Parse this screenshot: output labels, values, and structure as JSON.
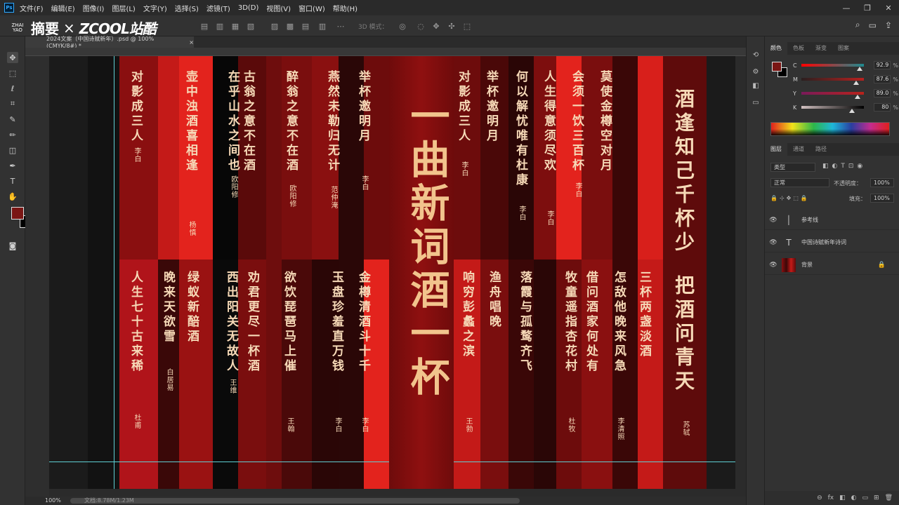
{
  "app": {
    "logo": "Ps",
    "menu": [
      "文件(F)",
      "编辑(E)",
      "图像(I)",
      "图层(L)",
      "文字(Y)",
      "选择(S)",
      "滤镜(T)",
      "3D(D)",
      "视图(V)",
      "窗口(W)",
      "帮助(H)"
    ],
    "window_controls": [
      "—",
      "❐",
      "✕"
    ]
  },
  "banner": {
    "mark_lines": [
      "ZHAI",
      "YAO"
    ],
    "zhaiyao": "摘要",
    "x": "×",
    "zcool": "ZCOOL站酷"
  },
  "options": {
    "mode_3d": "3D 模式："
  },
  "document": {
    "tab_title": "2024文案（中国诗赋新年）.psd @ 100% (CMYK/8#) *",
    "tab_close": "×",
    "zoom": "100%",
    "status": "文档:8.78M/1.23M"
  },
  "poster": {
    "title": "一曲新词酒一杯",
    "top_poems": [
      {
        "text": "对影成三人",
        "author": "李白"
      },
      {
        "text": "壶中浊酒喜相逢",
        "author": "杨慎"
      },
      {
        "text": "古翁之意不在酒",
        "author": ""
      },
      {
        "text": "在乎山水之间也",
        "author": "欧阳修"
      },
      {
        "text": "醉翁之意不在酒",
        "author": "欧阳修"
      },
      {
        "text": "燕然未勒归无计",
        "author": "范仲淹"
      },
      {
        "text": "举杯邀明月",
        "author": "李白"
      },
      {
        "text": "对影成三人",
        "author": "李白"
      },
      {
        "text": "举杯邀明月",
        "author": ""
      },
      {
        "text": "何以解忧唯有杜康",
        "author": "李白"
      },
      {
        "text": "人生得意须尽欢",
        "author": "李白"
      },
      {
        "text": "会须一饮三百杯",
        "author": "李白"
      },
      {
        "text": "莫使金樽空对月",
        "author": ""
      },
      {
        "text": "酒逢知己千杯少",
        "author": ""
      }
    ],
    "bottom_poems": [
      {
        "text": "人生七十古来稀",
        "author": "杜甫"
      },
      {
        "text": "晚来天欲雪",
        "author": "白居易"
      },
      {
        "text": "绿蚁新醅酒",
        "author": ""
      },
      {
        "text": "西出阳关无故人",
        "author": "王维"
      },
      {
        "text": "劝君更尽一杯酒",
        "author": ""
      },
      {
        "text": "欲饮琵琶马上催",
        "author": "王翰"
      },
      {
        "text": "玉盘珍羞直万钱",
        "author": "李白"
      },
      {
        "text": "金樽清酒斗十千",
        "author": "李白"
      },
      {
        "text": "响穷彭蠡之滨",
        "author": "王勃"
      },
      {
        "text": "渔舟唱晚",
        "author": ""
      },
      {
        "text": "落霞与孤鹜齐飞",
        "author": ""
      },
      {
        "text": "牧童遥指杏花村",
        "author": "杜牧"
      },
      {
        "text": "借问酒家何处有",
        "author": ""
      },
      {
        "text": "怎敌他晚来风急",
        "author": "李清照"
      },
      {
        "text": "三杯两盏淡酒",
        "author": ""
      },
      {
        "text": "把酒问青天",
        "author": "苏轼"
      }
    ]
  },
  "color_panel": {
    "tabs": [
      "颜色",
      "色板",
      "渐变",
      "图案"
    ],
    "channels": [
      {
        "label": "C",
        "value": 92.9,
        "display": "92.9",
        "track": "linear-gradient(90deg,#ff0000,#1e8a8f)"
      },
      {
        "label": "M",
        "value": 87.6,
        "display": "87.6",
        "track": "linear-gradient(90deg,#2a1f1f,#b8211f)"
      },
      {
        "label": "Y",
        "value": 89.0,
        "display": "89.0",
        "track": "linear-gradient(90deg,#7a1a5a,#b8221a)"
      },
      {
        "label": "K",
        "value": 80,
        "display": "80",
        "track": "linear-gradient(90deg,#d0c0c0,#000000)"
      }
    ],
    "percent": "%"
  },
  "layers_panel": {
    "tabs": [
      "图层",
      "通道",
      "路径"
    ],
    "kind_filter": "类型",
    "blend_mode": "正常",
    "opacity_label": "不透明度：",
    "opacity": "100%",
    "fill_label": "填充：",
    "fill": "100%",
    "layers": [
      {
        "name": "参考线",
        "thumb": "│",
        "locked": false
      },
      {
        "name": "中国诗赋新年诗词",
        "thumb": "T",
        "locked": false
      },
      {
        "name": "背景",
        "thumb": "",
        "locked": true
      }
    ],
    "footer_icons": [
      "⊖",
      "fx",
      "◧",
      "◐",
      "▭",
      "⊞",
      "🗑"
    ]
  },
  "colors": {
    "foreground": "#7a1614",
    "background": "#000000",
    "accent_guide": "#5fd0d4",
    "poster_text": "#f6d9b7",
    "poster_title": "#f2c48d"
  }
}
